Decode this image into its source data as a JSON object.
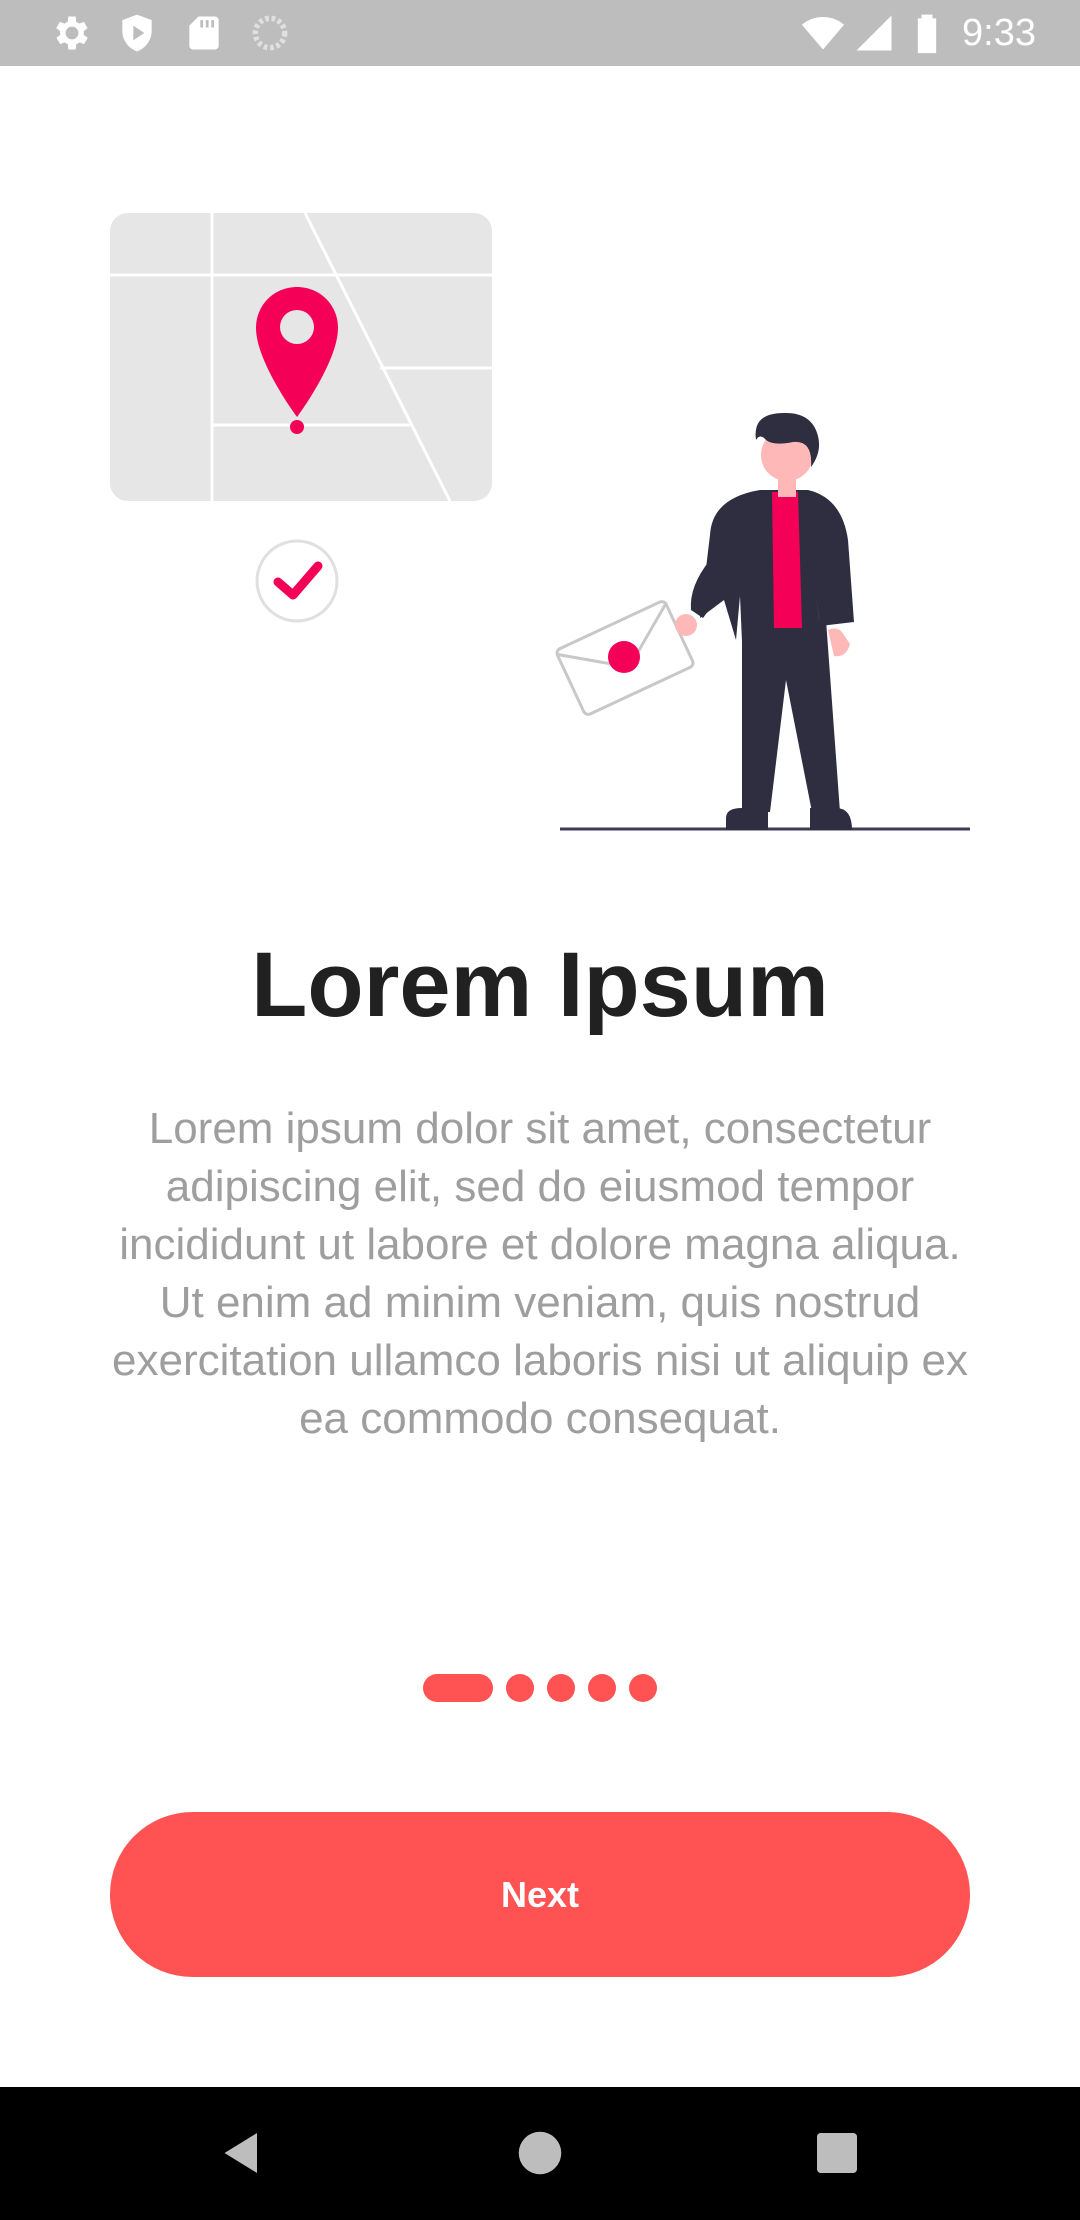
{
  "status_bar": {
    "time": "9:33",
    "left_icons": [
      "gear-icon",
      "shield-play-icon",
      "sd-card-icon",
      "sync-circle-icon"
    ],
    "right_icons": [
      "wifi-icon",
      "signal-icon",
      "battery-icon"
    ]
  },
  "onboarding": {
    "title": "Lorem Ipsum",
    "description": "Lorem ipsum dolor sit amet, consectetur adipiscing elit, sed do eiusmod tempor incididunt ut labore et dolore magna aliqua. Ut enim ad minim veniam, quis nostrud exercitation ullamco laboris nisi ut aliquip ex ea commodo consequat.",
    "page_count": 5,
    "current_page": 1,
    "next_label": "Next"
  },
  "colors": {
    "accent": "#ff5252",
    "illustration_accent": "#f50057",
    "title": "#212121",
    "body": "#9e9e9e",
    "status_bar": "#bdbdbd",
    "nav_bar": "#000000"
  },
  "nav_bar": {
    "buttons": [
      "back-icon",
      "home-icon",
      "recents-icon"
    ]
  }
}
